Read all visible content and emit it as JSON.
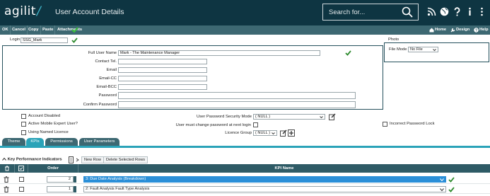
{
  "app": {
    "logo_text": "agilit",
    "logo_slash": "/",
    "title": "User Account Details",
    "search_placeholder": "Search for..."
  },
  "toolbar": {
    "ok": "OK",
    "cancel": "Cancel",
    "copy": "Copy",
    "paste": "Paste",
    "attachments": "Attachments",
    "home": "Home",
    "design": "Design",
    "help": "Help"
  },
  "login": {
    "label": "Login",
    "value": "SSG_Mark"
  },
  "photo": {
    "title": "Photo",
    "file_mode_label": "File Mode",
    "file_mode_value": "No File"
  },
  "fields": {
    "full_user_name_label": "Full User Name",
    "full_user_name_value": "Mark - The Maintenance Manager",
    "contact_tel_label": "Contact Tel.",
    "email_label": "Email",
    "email_cc_label": "Email-CC",
    "email_bcc_label": "Email-BCC",
    "password_label": "Password",
    "confirm_password_label": "Confirm Password"
  },
  "options": {
    "account_disabled": "Account Disabled",
    "active_mobile": "Active Mobile Expert User?",
    "named_licence": "Using Named Licence",
    "pw_security_label": "User Password Security Mode",
    "pw_security_value": "( NULL )",
    "must_change_pw": "User must change password at next login",
    "licence_group_label": "Licence Group",
    "licence_group_value": "( NULL )",
    "incorrect_pw_lock": "Incorrect Password Lock"
  },
  "tabs": [
    "Theme",
    "KPIs",
    "Permissions",
    "User Parameters"
  ],
  "active_tab": "KPIs",
  "grid": {
    "title": "Key Performance Indicators",
    "new_row": "New Row",
    "delete_rows": "Delete Selected Rows",
    "col_order": "Order",
    "col_kpi": "KPI Name",
    "rows": [
      {
        "order": "2",
        "kpi": "3: Due Date Analysis (Breakdown)"
      },
      {
        "order": "1",
        "kpi": "2: Fault Analysis Fault Type Analysis"
      }
    ]
  },
  "colors": {
    "header_bg": "#0e3542",
    "toolbar_bg": "#3d6872",
    "accent": "#2aa3b8",
    "check_green": "#2e8b2e"
  }
}
